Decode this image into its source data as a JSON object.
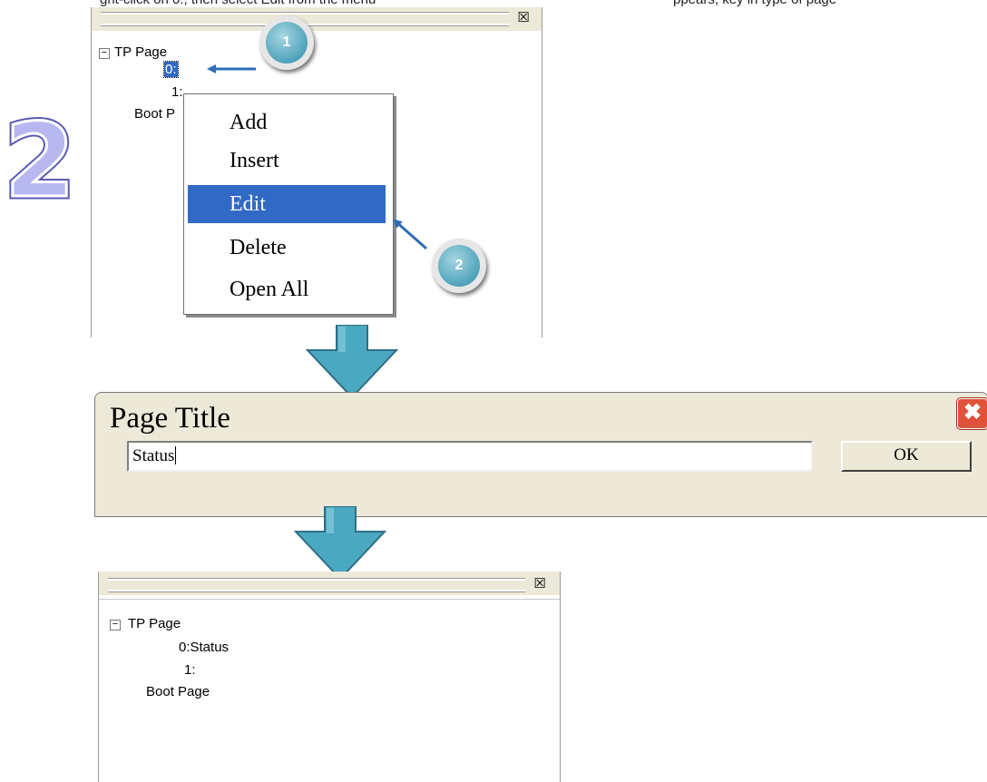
{
  "captions": {
    "top_left": "ght-click on 0:, then select Edit from the menu",
    "top_right": "ppears, key in type of page"
  },
  "step": {
    "number": "2"
  },
  "panel_before": {
    "close_glyph": "☒",
    "tree": {
      "root_label": "TP Page",
      "expander": "−",
      "items": [
        "0:",
        "1:"
      ],
      "boot_label": "Boot P"
    }
  },
  "context_menu": {
    "items": [
      {
        "label": "Add"
      },
      {
        "label": "Insert"
      },
      {
        "label": "Edit",
        "active": true
      },
      {
        "label": "Delete"
      },
      {
        "label": "Open All"
      }
    ]
  },
  "callouts": [
    {
      "label": "1"
    },
    {
      "label": "2"
    }
  ],
  "dialog": {
    "title": "Page Title",
    "close_glyph": "✖",
    "input_value": "Status",
    "ok_label": "OK"
  },
  "panel_after": {
    "close_glyph": "☒",
    "tree": {
      "root_label": "TP Page",
      "expander": "−",
      "items": [
        "0:Status",
        "1:"
      ],
      "boot_label": "Boot Page"
    }
  },
  "colors": {
    "menu_highlight": "#316ac5",
    "callout_fill": "#4fa3bb",
    "arrow_fill": "#4aa8c0",
    "step_number_fill": "#b8b8f0",
    "close_button": "#e0533b"
  }
}
